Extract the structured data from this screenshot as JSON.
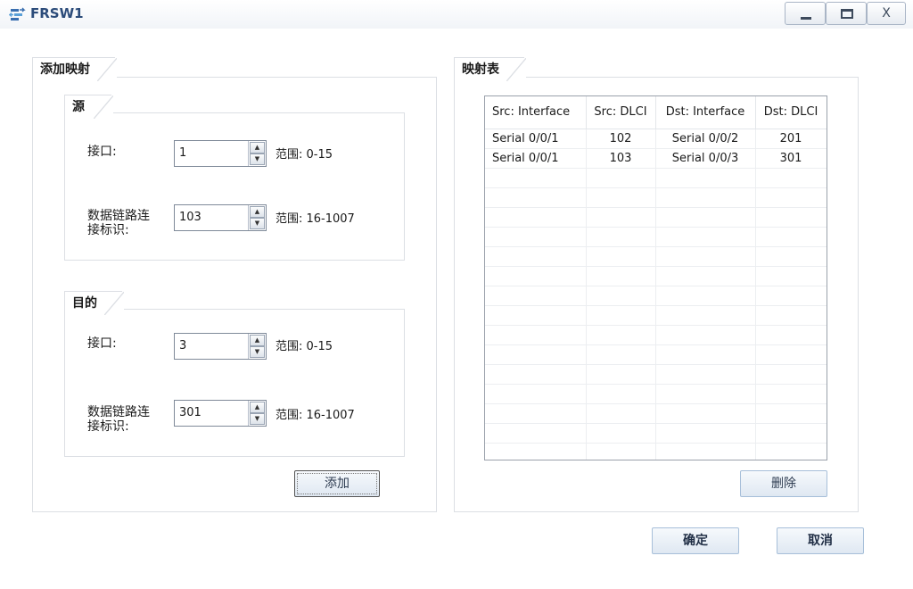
{
  "window": {
    "title": "FRSW1",
    "minimize": "_",
    "maximize": "□",
    "close": "X"
  },
  "add_mapping": {
    "title": "添加映射",
    "source": {
      "title": "源",
      "interface_label": "接口:",
      "interface_value": "1",
      "interface_range": "范围: 0-15",
      "dlci_label_line1": "数据链路连",
      "dlci_label_line2": "接标识:",
      "dlci_value": "103",
      "dlci_range": "范围: 16-1007"
    },
    "destination": {
      "title": "目的",
      "interface_label": "接口:",
      "interface_value": "3",
      "interface_range": "范围: 0-15",
      "dlci_label_line1": "数据链路连",
      "dlci_label_line2": "接标识:",
      "dlci_value": "301",
      "dlci_range": "范围: 16-1007"
    },
    "add_button": "添加"
  },
  "mapping_table": {
    "title": "映射表",
    "columns": [
      "Src: Interface",
      "Src: DLCI",
      "Dst: Interface",
      "Dst: DLCI"
    ],
    "rows": [
      [
        "Serial 0/0/1",
        "102",
        "Serial 0/0/2",
        "201"
      ],
      [
        "Serial 0/0/1",
        "103",
        "Serial 0/0/3",
        "301"
      ]
    ],
    "delete_button": "删除"
  },
  "footer": {
    "ok_button": "确定",
    "cancel_button": "取消"
  }
}
